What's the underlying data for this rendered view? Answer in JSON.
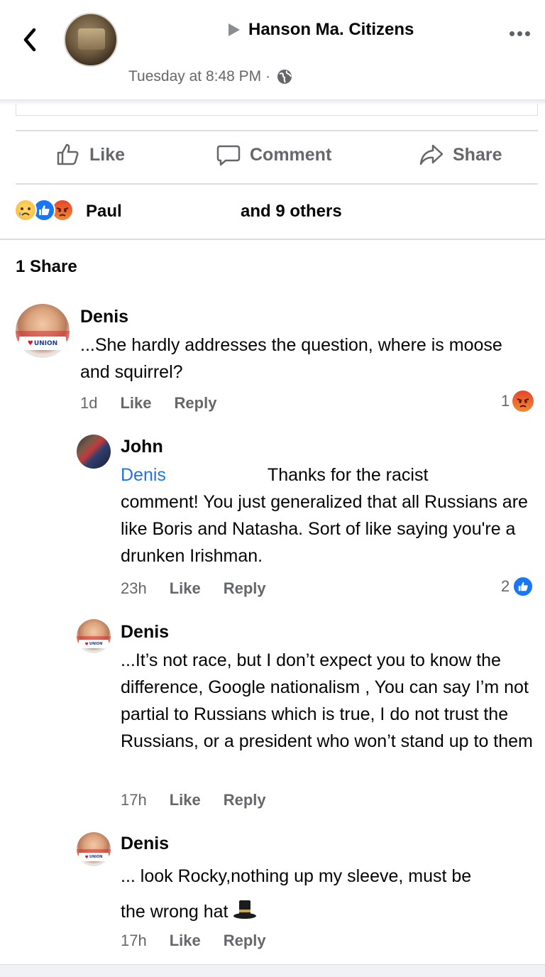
{
  "header": {
    "group_name": "Hanson Ma. Citizens",
    "timestamp": "Tuesday at 8:48 PM ·",
    "back_icon": "chevron-left-icon",
    "more_icon": "more-horizontal-icon"
  },
  "actions": {
    "like": "Like",
    "comment": "Comment",
    "share": "Share"
  },
  "reactions": {
    "types": [
      "sad",
      "like",
      "angry"
    ],
    "name": "Paul",
    "others": "and 9 others"
  },
  "shares": "1 Share",
  "comments": [
    {
      "author": "Denis",
      "badge": "UNION",
      "text": "...She hardly addresses the question, where is moose and squirrel?",
      "time": "1d",
      "like": "Like",
      "reply": "Reply",
      "reaction_count": "1",
      "reaction_type": "angry"
    },
    {
      "author": "John",
      "mention": "Denis",
      "text_line1": "Thanks for the racist",
      "text_rest": "comment! You just generalized that all Russians are like Boris and Natasha. Sort of like saying you're a drunken Irishman.",
      "time": "23h",
      "like": "Like",
      "reply": "Reply",
      "reaction_count": "2",
      "reaction_type": "like"
    },
    {
      "author": "Denis",
      "badge": "UNION",
      "text": "...It’s not race, but I don’t expect you to know the difference, Google nationalism , You can say I’m not partial to Russians which is true, I do not trust the Russians, or a president who won’t stand up to them",
      "time": "17h",
      "like": "Like",
      "reply": "Reply"
    },
    {
      "author": "Denis",
      "badge": "UNION",
      "text_line1": "... look Rocky,nothing up my sleeve, must be",
      "text_line2": "the wrong hat",
      "emoji": "top-hat-icon",
      "time": "17h",
      "like": "Like",
      "reply": "Reply"
    }
  ]
}
